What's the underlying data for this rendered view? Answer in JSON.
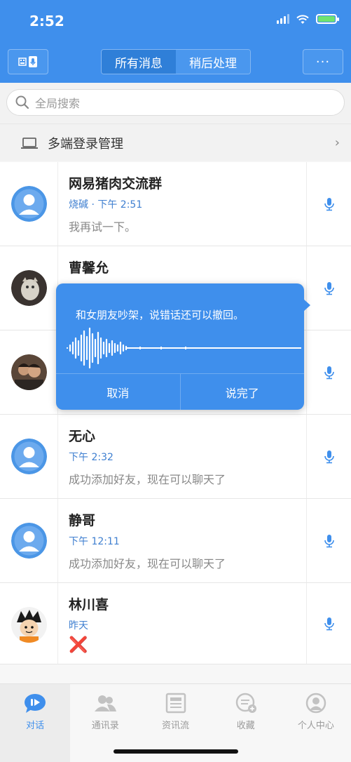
{
  "status": {
    "time": "2:52"
  },
  "header": {
    "tabs": [
      {
        "label": "所有消息",
        "active": true
      },
      {
        "label": "稍后处理",
        "active": false
      }
    ],
    "more_label": "···"
  },
  "search": {
    "placeholder": "全局搜索"
  },
  "multi_login": {
    "label": "多端登录管理"
  },
  "chats": [
    {
      "name": "网易猪肉交流群",
      "meta": "烧碱 · 下午 2:51",
      "message": "我再试一下。",
      "avatar": "default"
    },
    {
      "name": "曹馨允",
      "meta": "",
      "message": "",
      "avatar": "photo-cat"
    },
    {
      "name": "",
      "meta": "",
      "message": "",
      "avatar": "photo-people"
    },
    {
      "name": "无心",
      "meta": "下午 2:32",
      "message": "成功添加好友，现在可以聊天了",
      "avatar": "default"
    },
    {
      "name": "静哥",
      "meta": "下午 12:11",
      "message": "成功添加好友，现在可以聊天了",
      "avatar": "default"
    },
    {
      "name": "林川喜",
      "meta": "昨天",
      "message": "❌",
      "avatar": "photo-cartoon"
    }
  ],
  "voice_popup": {
    "transcript": "和女朋友吵架，说错话还可以撤回。",
    "cancel_label": "取消",
    "done_label": "说完了"
  },
  "tabbar": [
    {
      "label": "对话",
      "icon": "chat-icon",
      "active": true
    },
    {
      "label": "通讯录",
      "icon": "contacts-icon",
      "active": false
    },
    {
      "label": "资讯流",
      "icon": "news-icon",
      "active": false
    },
    {
      "label": "收藏",
      "icon": "favorites-icon",
      "active": false
    },
    {
      "label": "个人中心",
      "icon": "profile-icon",
      "active": false
    }
  ],
  "colors": {
    "accent": "#3f8fec",
    "meta": "#3f7fd0"
  }
}
